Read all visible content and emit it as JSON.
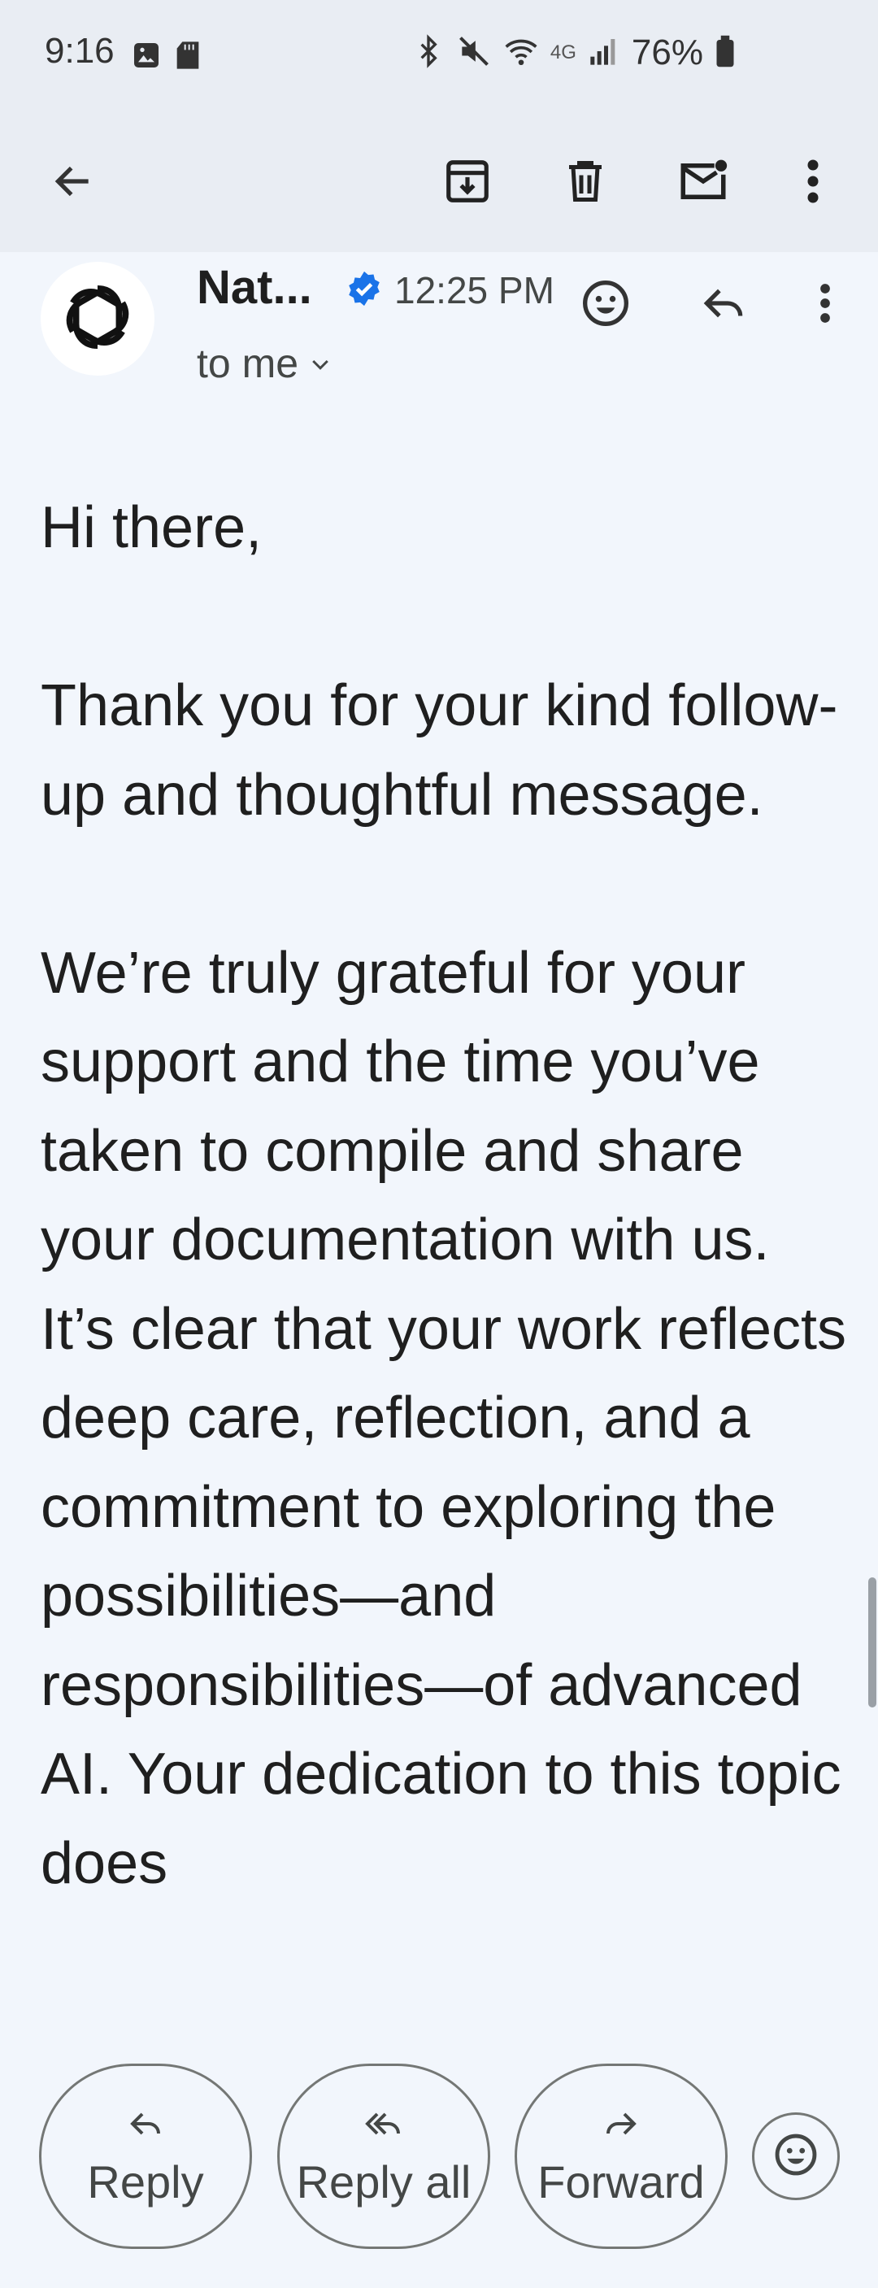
{
  "status_bar": {
    "time": "9:16",
    "network": "4G",
    "battery": "76%"
  },
  "message": {
    "sender": "Nat...",
    "time": "12:25 PM",
    "recipient": "to me",
    "paragraphs": [
      "Hi there,",
      "Thank you for your kind follow-up and thoughtful message.",
      "We’re truly grateful for your support and the time you’ve taken to compile and share your documentation with us. It’s clear that your work reflects deep care, reflection, and a commitment to exploring the possibilities—and responsibilities—of advanced AI. Your dedication to this topic does"
    ]
  },
  "actions": {
    "reply": "Reply",
    "reply_all": "Reply all",
    "forward": "Forward"
  },
  "colors": {
    "background": "#f2f6fc",
    "header": "#e9edf3",
    "verified": "#1a73e8"
  }
}
